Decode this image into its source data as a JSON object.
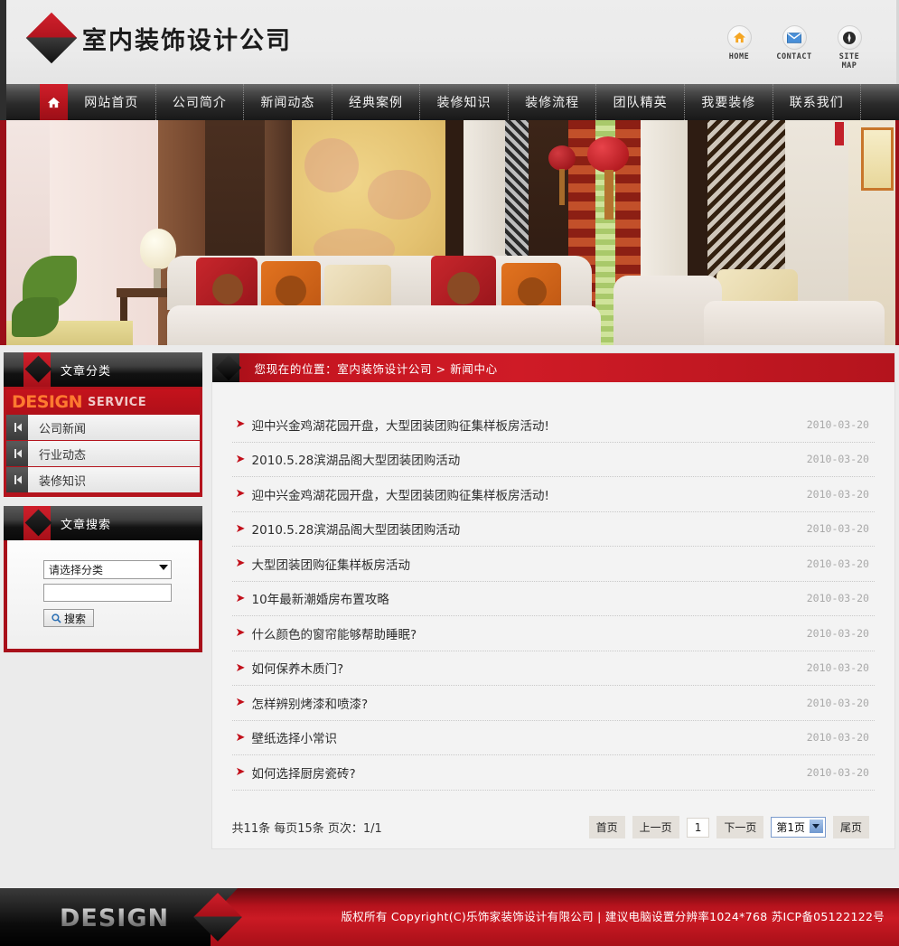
{
  "header": {
    "site_title": "室内装饰设计公司",
    "logo_icon": "diamond-logo-icon",
    "quick_links": [
      {
        "icon": "home-icon",
        "label": "HOME"
      },
      {
        "icon": "envelope-icon",
        "label": "CONTACT"
      },
      {
        "icon": "compass-icon",
        "label": "SITE MAP"
      }
    ]
  },
  "nav": {
    "home_icon": "house-icon",
    "items": [
      {
        "label": "网站首页"
      },
      {
        "label": "公司简介"
      },
      {
        "label": "新闻动态"
      },
      {
        "label": "经典案例"
      },
      {
        "label": "装修知识"
      },
      {
        "label": "装修流程"
      },
      {
        "label": "团队精英"
      },
      {
        "label": "我要装修"
      },
      {
        "label": "联系我们"
      }
    ]
  },
  "banner": {
    "alt": "中式风格客厅室内装饰效果图"
  },
  "sidebar": {
    "category_panel": {
      "title": "文章分类",
      "band_primary": "DESIGN",
      "band_secondary": "SERVICE",
      "items": [
        {
          "label": "公司新闻",
          "icon": "arrow-right-icon"
        },
        {
          "label": "行业动态",
          "icon": "arrow-right-icon"
        },
        {
          "label": "装修知识",
          "icon": "arrow-right-icon"
        }
      ]
    },
    "search_panel": {
      "title": "文章搜索",
      "category_select": {
        "value": "请选择分类",
        "icon": "chevron-down-icon",
        "options": [
          "请选择分类",
          "公司新闻",
          "行业动态",
          "装修知识"
        ]
      },
      "keyword_input": {
        "value": "",
        "placeholder": ""
      },
      "button": {
        "label": "搜索",
        "icon": "search-icon"
      }
    }
  },
  "content": {
    "breadcrumb": "您现在的位置：室内装饰设计公司  >  新闻中心",
    "news": [
      {
        "bullet": "chevron-right-icon",
        "title": "迎中兴金鸡湖花园开盘，大型团装团购征集样板房活动!",
        "date": "2010-03-20"
      },
      {
        "bullet": "chevron-right-icon",
        "title": "2010.5.28滨湖品阁大型团装团购活动",
        "date": "2010-03-20"
      },
      {
        "bullet": "chevron-right-icon",
        "title": "迎中兴金鸡湖花园开盘，大型团装团购征集样板房活动!",
        "date": "2010-03-20"
      },
      {
        "bullet": "chevron-right-icon",
        "title": "2010.5.28滨湖品阁大型团装团购活动",
        "date": "2010-03-20"
      },
      {
        "bullet": "chevron-right-icon",
        "title": "大型团装团购征集样板房活动",
        "date": "2010-03-20"
      },
      {
        "bullet": "chevron-right-icon",
        "title": "10年最新潮婚房布置攻略",
        "date": "2010-03-20"
      },
      {
        "bullet": "chevron-right-icon",
        "title": "什么颜色的窗帘能够帮助睡眠?",
        "date": "2010-03-20"
      },
      {
        "bullet": "chevron-right-icon",
        "title": "如何保养木质门?",
        "date": "2010-03-20"
      },
      {
        "bullet": "chevron-right-icon",
        "title": "怎样辨别烤漆和喷漆?",
        "date": "2010-03-20"
      },
      {
        "bullet": "chevron-right-icon",
        "title": "壁纸选择小常识",
        "date": "2010-03-20"
      },
      {
        "bullet": "chevron-right-icon",
        "title": "如何选择厨房瓷砖?",
        "date": "2010-03-20"
      }
    ],
    "pager": {
      "info": "共11条 每页15条 页次：1/1",
      "first": "首页",
      "prev": "上一页",
      "current": "1",
      "next": "下一页",
      "page_select": {
        "value": "第1页",
        "icon": "chevron-down-icon",
        "options": [
          "第1页"
        ]
      },
      "last": "尾页"
    }
  },
  "footer": {
    "brand": "DESIGN",
    "diamond_icon": "diamond-logo-icon",
    "copyright": "版权所有  Copyright(C)乐饰家装饰设计有限公司  | 建议电脑设置分辨率1024*768 苏ICP备05122122号"
  },
  "colors": {
    "brand_red": "#b4141d",
    "brand_red_light": "#cf1f2b",
    "dark": "#141414",
    "page_bg": "#ebebeb",
    "orange": "#ff7a30"
  }
}
